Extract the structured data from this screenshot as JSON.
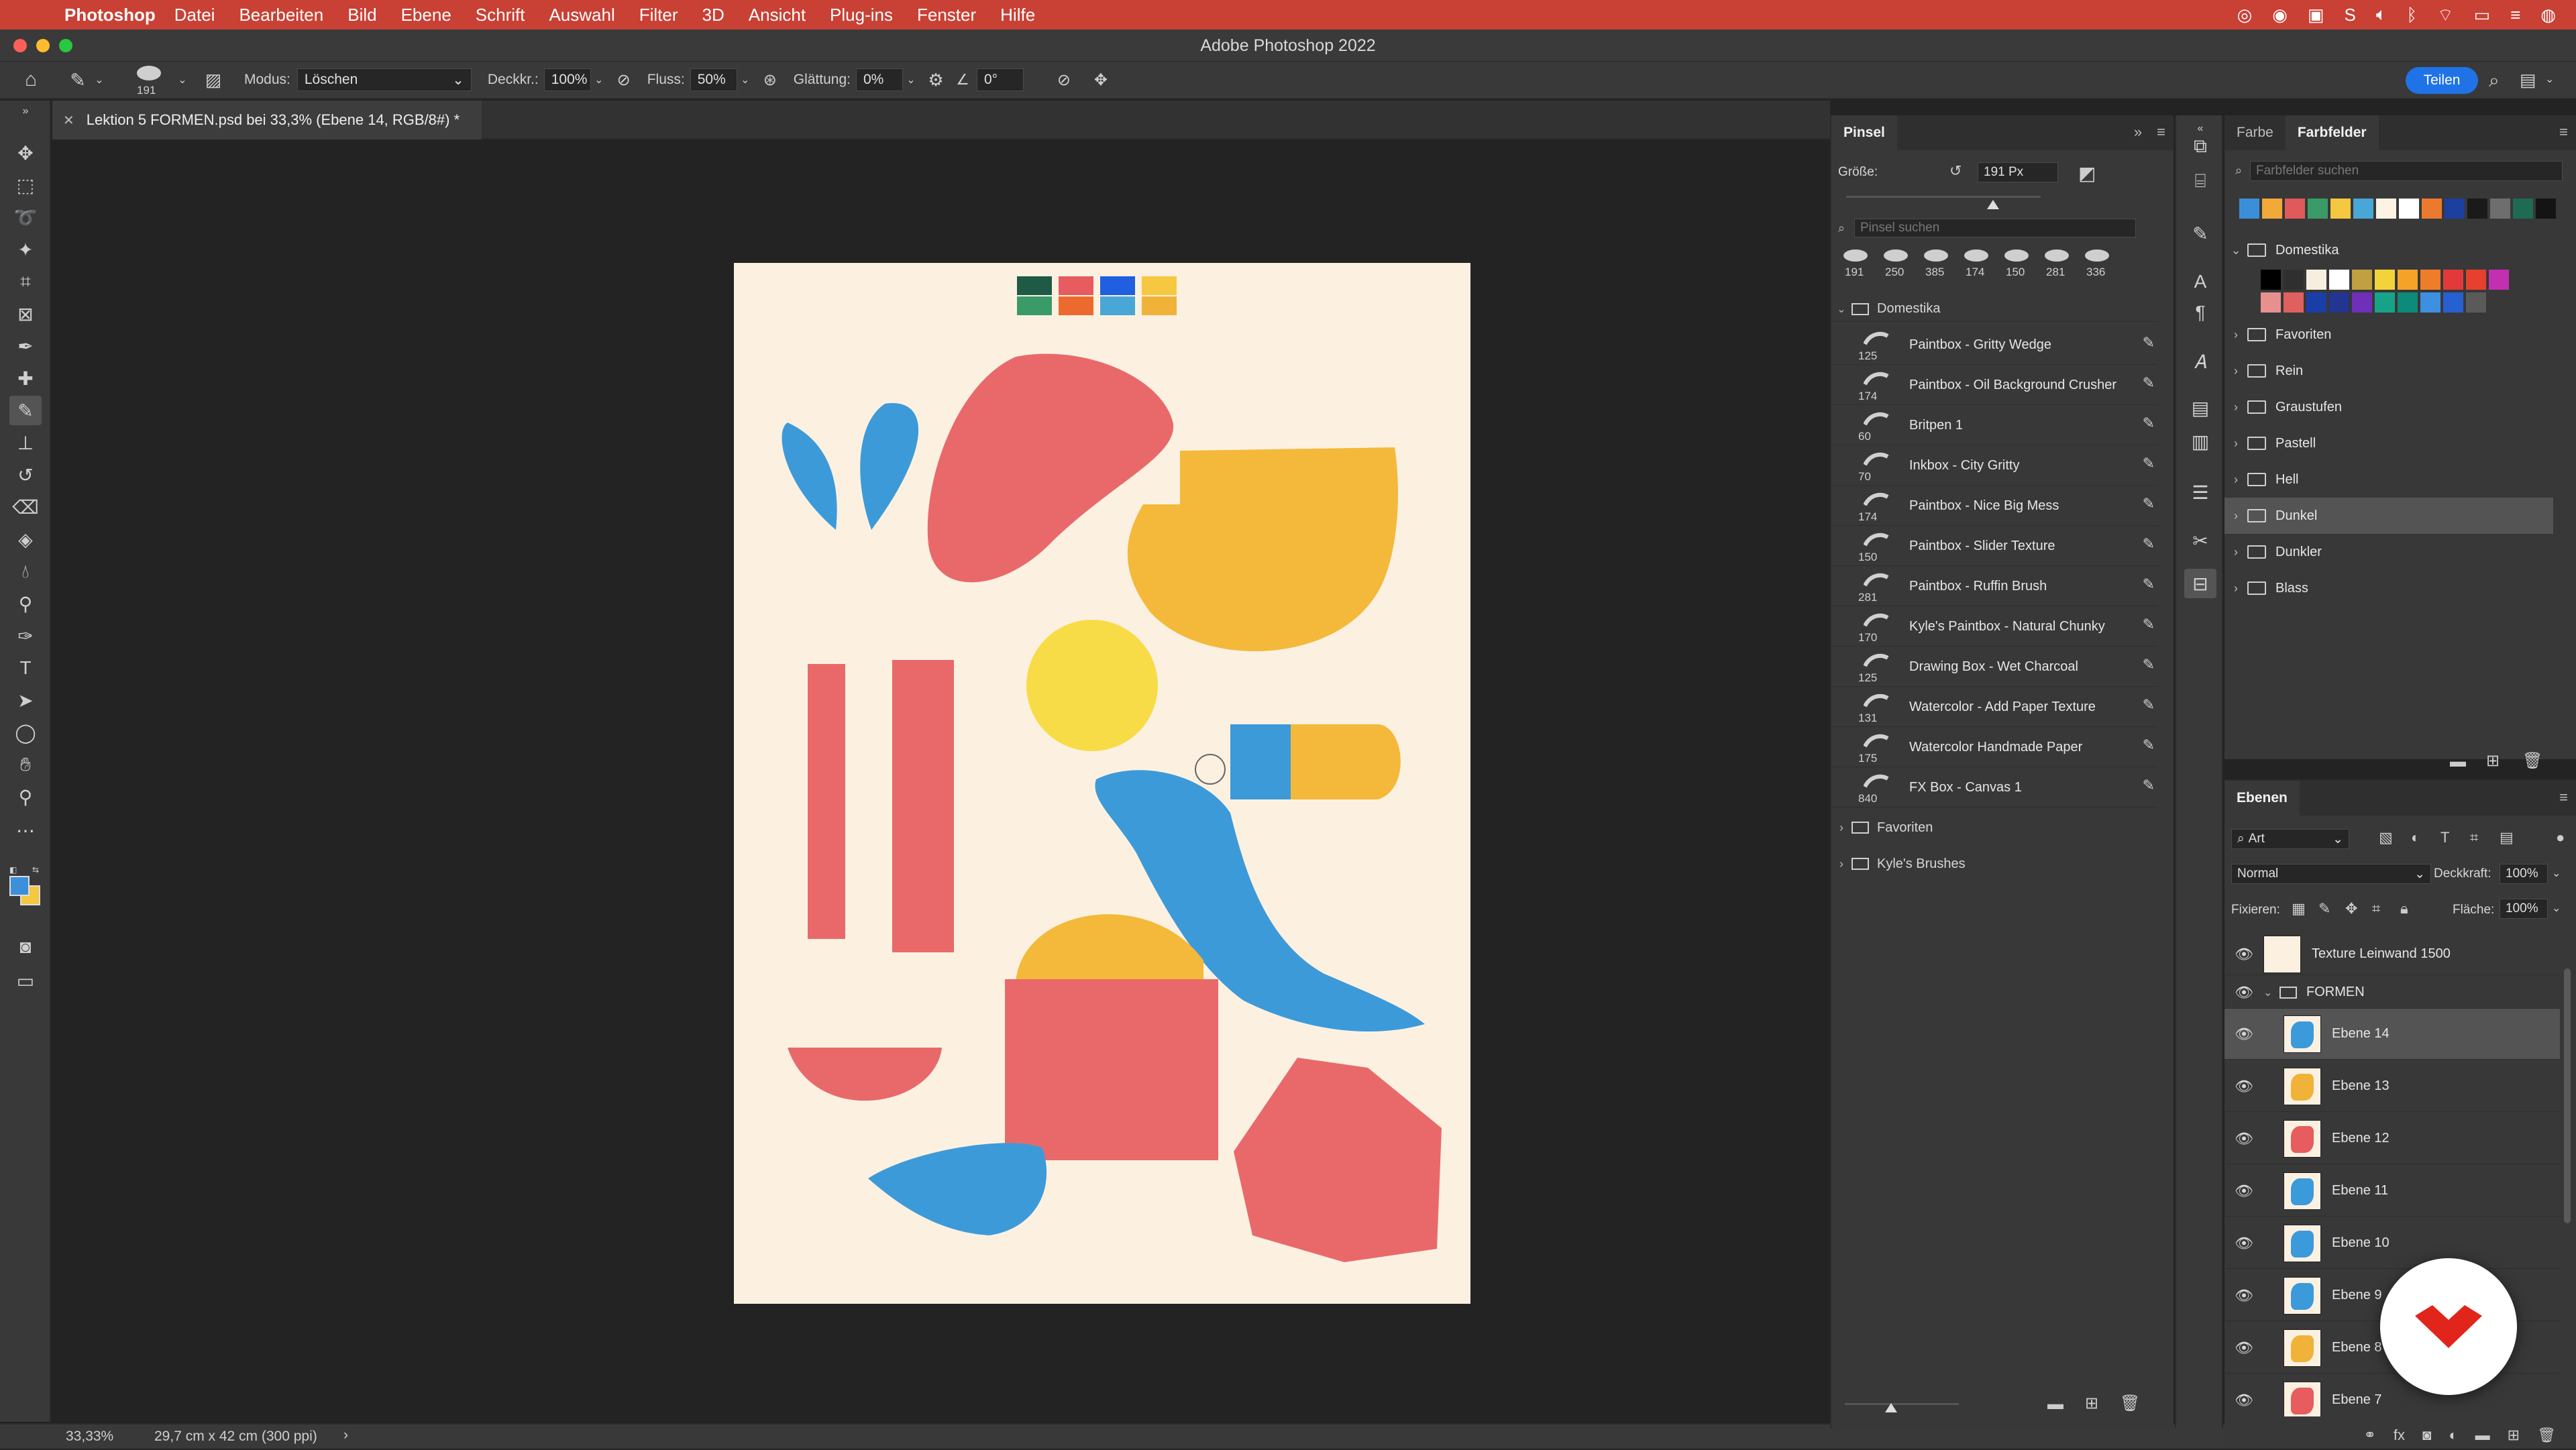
{
  "menubar": {
    "app_name": "Photoshop",
    "items": [
      "Datei",
      "Bearbeiten",
      "Bild",
      "Ebene",
      "Schrift",
      "Auswahl",
      "Filter",
      "3D",
      "Ansicht",
      "Plug-ins",
      "Fenster",
      "Hilfe"
    ]
  },
  "window": {
    "title": "Adobe Photoshop 2022"
  },
  "options": {
    "brush_size": "191",
    "mode_label": "Modus:",
    "mode_value": "Löschen",
    "opacity_label": "Deckkr.:",
    "opacity_value": "100%",
    "flow_label": "Fluss:",
    "flow_value": "50%",
    "smoothing_label": "Glättung:",
    "smoothing_value": "0%",
    "angle_value": "0°",
    "share_label": "Teilen"
  },
  "document": {
    "tab_title": "Lektion 5 FORMEN.psd bei 33,3% (Ebene 14, RGB/8#) *"
  },
  "status": {
    "zoom": "33,33%",
    "doc_size": "29,7 cm x 42 cm (300 ppi)",
    "arrow": "›"
  },
  "brush_panel": {
    "tab": "Pinsel",
    "size_label": "Größe:",
    "size_value": "191 Px",
    "search_placeholder": "Pinsel suchen",
    "recent_sizes": [
      "191",
      "250",
      "385",
      "174",
      "150",
      "281",
      "336"
    ],
    "group_name": "Domestika",
    "brushes": [
      {
        "size": "125",
        "name": "Paintbox - Gritty Wedge"
      },
      {
        "size": "174",
        "name": "Paintbox - Oil Background Crusher"
      },
      {
        "size": "60",
        "name": "Britpen 1"
      },
      {
        "size": "70",
        "name": "Inkbox - City Gritty"
      },
      {
        "size": "174",
        "name": "Paintbox - Nice Big Mess"
      },
      {
        "size": "150",
        "name": "Paintbox - Slider Texture"
      },
      {
        "size": "281",
        "name": "Paintbox - Ruffin Brush"
      },
      {
        "size": "170",
        "name": "Kyle's Paintbox - Natural Chunky"
      },
      {
        "size": "125",
        "name": "Drawing Box - Wet Charcoal"
      },
      {
        "size": "131",
        "name": "Watercolor - Add Paper Texture"
      },
      {
        "size": "175",
        "name": "Watercolor Handmade Paper"
      },
      {
        "size": "840",
        "name": "FX Box - Canvas 1"
      }
    ],
    "other_groups": [
      "Favoriten",
      "Kyle's Brushes"
    ]
  },
  "swatches_panel": {
    "tabs": [
      "Farbe",
      "Farbfelder"
    ],
    "search_placeholder": "Farbfelder suchen",
    "recent_colors": [
      "#3b8fd9",
      "#f1a93a",
      "#e0595b",
      "#3a9a68",
      "#f6c740",
      "#48a7d6",
      "#fdf3e3",
      "#ffffff",
      "#ec7a2e",
      "#1c3fa0",
      "#1a1a1a",
      "#6e6e6e",
      "#1e6a53",
      "#141414"
    ],
    "open_group": "Domestika",
    "group_colors_row1": [
      "#000000",
      "#2f2f2f",
      "#f6efe0",
      "#ffffff",
      "#c0a040",
      "#f2d43a",
      "#f4a228",
      "#ee7d2b",
      "#e23a3a",
      "#e8402e",
      "#c22fb0"
    ],
    "group_colors_row2": [
      "#e89090",
      "#e06060",
      "#1a3ea8",
      "#223590",
      "#6f2fb8",
      "#17a389",
      "#0e8a7a",
      "#3f8fe0",
      "#2760d0",
      "#5a5a5a"
    ],
    "folders": [
      "Favoriten",
      "Rein",
      "Graustufen",
      "Pastell",
      "Hell",
      "Dunkel",
      "Dunkler",
      "Blass"
    ],
    "selected_folder": "Dunkel"
  },
  "layers_panel": {
    "tab": "Ebenen",
    "filter_value": "Art",
    "blend_mode": "Normal",
    "opacity_label": "Deckkraft:",
    "opacity_value": "100%",
    "lock_label": "Fixieren:",
    "fill_label": "Fläche:",
    "fill_value": "100%",
    "layers": [
      {
        "name": "Texture Leinwand 1500",
        "type": "layer",
        "indent": 0
      },
      {
        "name": "FORMEN",
        "type": "group",
        "indent": 0
      },
      {
        "name": "Ebene 14",
        "type": "layer",
        "indent": 1,
        "color": "#3b9ad9",
        "selected": true
      },
      {
        "name": "Ebene 13",
        "type": "layer",
        "indent": 1,
        "color": "#f1b23a"
      },
      {
        "name": "Ebene 12",
        "type": "layer",
        "indent": 1,
        "color": "#e75c5e"
      },
      {
        "name": "Ebene 11",
        "type": "layer",
        "indent": 1,
        "color": "#3b9ad9"
      },
      {
        "name": "Ebene 10",
        "type": "layer",
        "indent": 1,
        "color": "#3b9ad9"
      },
      {
        "name": "Ebene 9",
        "type": "layer",
        "indent": 1,
        "color": "#3b9ad9"
      },
      {
        "name": "Ebene 8",
        "type": "layer",
        "indent": 1,
        "color": "#f1b23a"
      },
      {
        "name": "Ebene 7",
        "type": "layer",
        "indent": 1,
        "color": "#e75c5e"
      }
    ]
  },
  "artwork": {
    "palette": [
      "#1e5a45",
      "#e75c5e",
      "#1f5fe0",
      "#f6c740",
      "#3a9a68",
      "#ec6a2e",
      "#48a7d6",
      "#f1b23a"
    ],
    "colors": {
      "red": "#e9696b",
      "yellow": "#f4b93a",
      "lemon": "#f8dc47",
      "blue": "#3d9ad9",
      "paper": "#fcf1e1"
    }
  }
}
